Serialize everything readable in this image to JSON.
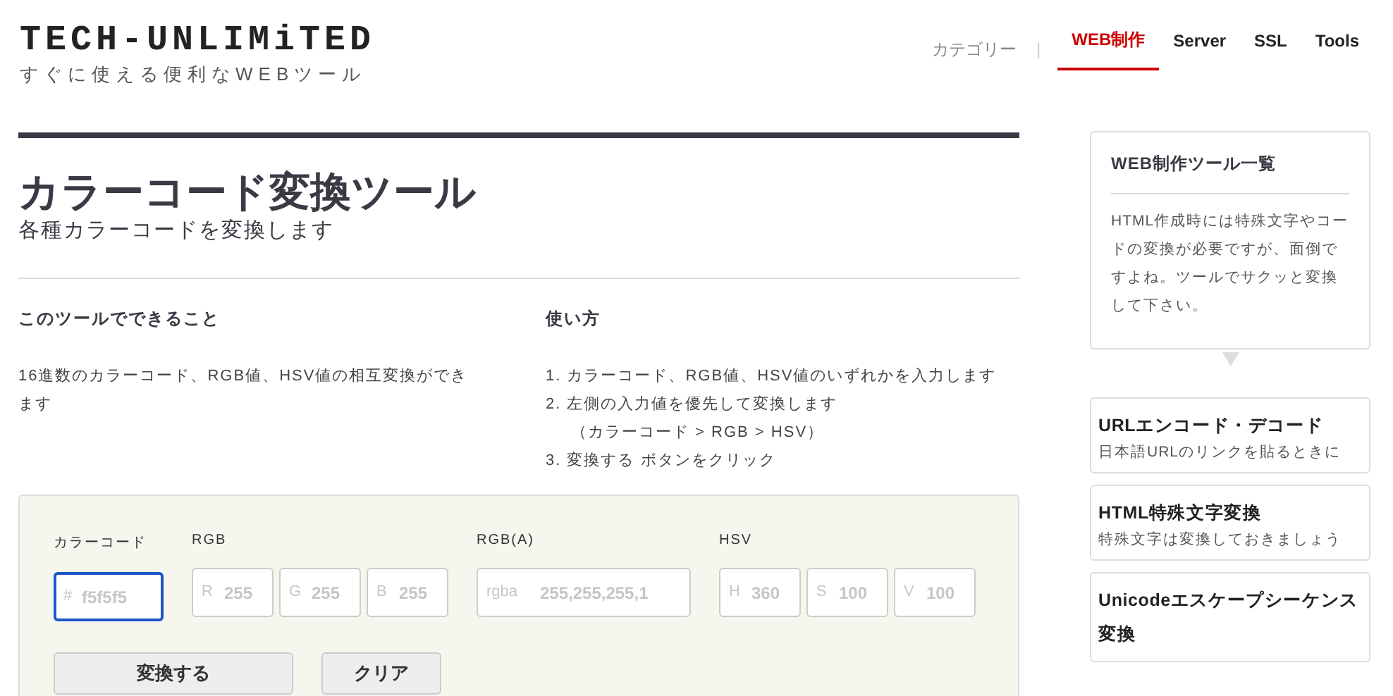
{
  "header": {
    "logo": "TECH-UNLIMiTED",
    "tagline": "すぐに使える便利なWEBツール",
    "nav_label": "カテゴリー",
    "nav_separator": "|",
    "nav": [
      {
        "label": "WEB制作",
        "selected": true
      },
      {
        "label": "Server",
        "selected": false
      },
      {
        "label": "SSL",
        "selected": false
      },
      {
        "label": "Tools",
        "selected": false
      }
    ]
  },
  "page": {
    "title": "カラーコード変換ツール",
    "subtitle": "各種カラーコードを変換します",
    "about": {
      "heading": "このツールでできること",
      "text": "16進数のカラーコード、RGB値、HSV値の相互変換ができます"
    },
    "usage": {
      "heading": "使い方",
      "steps": [
        {
          "number": "1.",
          "text": "カラーコード、RGB値、HSV値のいずれかを入力します"
        },
        {
          "number": "2.",
          "text": "左側の入力値を優先して変換します",
          "note": "（カラーコード > RGB > HSV）"
        },
        {
          "number": "3.",
          "text": "変換する ボタンをクリック"
        }
      ]
    }
  },
  "converter": {
    "groups": [
      {
        "label": "カラーコード",
        "fields": [
          {
            "prefix": "#",
            "placeholder": "f5f5f5",
            "focused": true
          }
        ]
      },
      {
        "label": "RGB",
        "fields": [
          {
            "prefix": "R",
            "placeholder": "255",
            "focused": false
          },
          {
            "prefix": "G",
            "placeholder": "255",
            "focused": false
          },
          {
            "prefix": "B",
            "placeholder": "255",
            "focused": false
          }
        ]
      },
      {
        "label": "RGB(A)",
        "fields": [
          {
            "prefix": "rgba",
            "placeholder": "255,255,255,1",
            "focused": false
          }
        ]
      },
      {
        "label": "HSV",
        "fields": [
          {
            "prefix": "H",
            "placeholder": "360",
            "focused": false
          },
          {
            "prefix": "S",
            "placeholder": "100",
            "focused": false
          },
          {
            "prefix": "V",
            "placeholder": "100",
            "focused": false
          }
        ]
      }
    ],
    "buttons": [
      {
        "label": "変換する",
        "kind": "primary"
      },
      {
        "label": "クリア",
        "kind": "secondary"
      }
    ]
  },
  "sidebar": {
    "intro": {
      "title": "WEB制作ツール一覧",
      "text": "HTML作成時には特殊文字やコードの変換が必要ですが、面倒ですよね。ツールでサクッと変換して下さい。"
    },
    "links": [
      {
        "title": "URLエンコード・デコード",
        "description": "日本語URLのリンクを貼るときに"
      },
      {
        "title": "HTML特殊文字変換",
        "description": "特殊文字は変換しておきましょう"
      },
      {
        "title": "Unicodeエスケープシーケンス変換"
      }
    ]
  }
}
